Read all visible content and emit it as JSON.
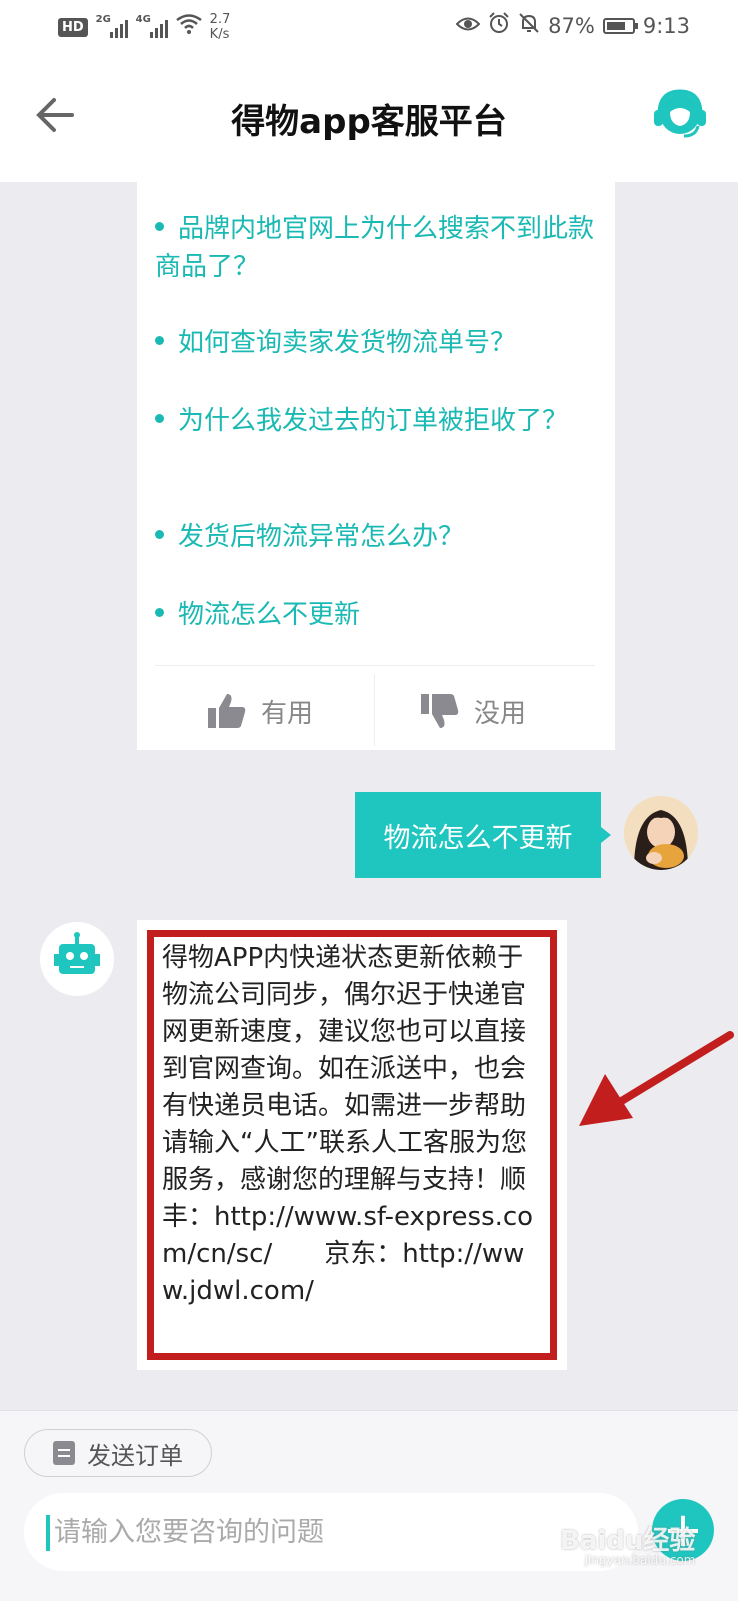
{
  "status_bar": {
    "hd_label": "HD",
    "net1": "2G",
    "net2": "4G",
    "speed_value": "2.7",
    "speed_unit": "K/s",
    "battery": "87%",
    "time": "9:13"
  },
  "header": {
    "title": "得物app客服平台"
  },
  "faq": {
    "items": [
      "品牌内地官网上为什么搜索不到此款商品了？",
      "如何查询卖家发货物流单号？",
      "为什么我发过去的订单被拒收了？",
      "发货后物流异常怎么办？",
      "物流怎么不更新"
    ],
    "useful_label": "有用",
    "useless_label": "没用"
  },
  "user_message": "物流怎么不更新",
  "bot_message": "得物APP内快递状态更新依赖于物流公司同步，偶尔迟于快递官网更新速度，建议您也可以直接到官网查询。如在派送中，也会有快递员电话。如需进一步帮助请输入“人工”联系人工客服为您服务，感谢您的理解与支持！顺丰：http://www.sf-express.com/cn/sc/　　京东：http://www.jdwl.com/",
  "bottom": {
    "order_button": "发送订单",
    "input_placeholder": "请输入您要咨询的问题"
  },
  "watermark": {
    "text": "Baidu经验",
    "sub": "jingyan.baidu.com"
  },
  "colors": {
    "accent": "#1fc6c0",
    "highlight_frame": "#c21e1e"
  }
}
